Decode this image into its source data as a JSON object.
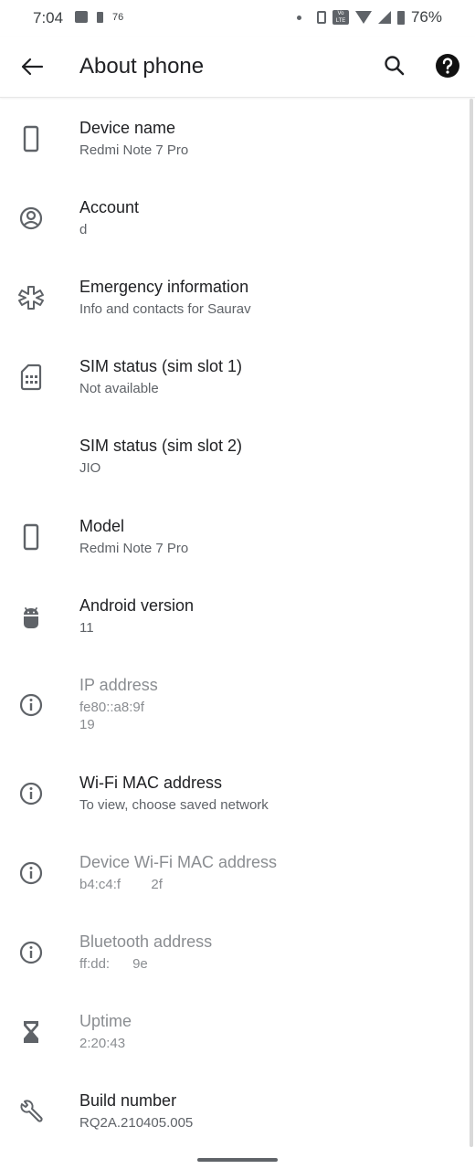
{
  "status_bar": {
    "time": "7:04",
    "small_indicator": "76",
    "volte_label": "Vo LTE",
    "battery_percent": "76%"
  },
  "toolbar": {
    "title": "About phone"
  },
  "items": [
    {
      "title": "Device name",
      "subtitle": "Redmi Note 7 Pro",
      "icon": "phone-icon"
    },
    {
      "title": "Account",
      "subtitle": "d",
      "icon": "account-circle-icon"
    },
    {
      "title": "Emergency information",
      "subtitle": "Info and contacts for Saurav",
      "icon": "medical-asterisk-icon"
    },
    {
      "title": "SIM status (sim slot 1)",
      "subtitle": "Not available",
      "icon": "sim-card-icon"
    },
    {
      "title": "SIM status (sim slot 2)",
      "subtitle": "JIO",
      "icon": ""
    },
    {
      "title": "Model",
      "subtitle": "Redmi Note 7 Pro",
      "icon": "phone-icon"
    },
    {
      "title": "Android version",
      "subtitle": "11",
      "icon": "android-icon"
    },
    {
      "title": "IP address",
      "subtitle": "fe80::a8:9f",
      "subtitle2": "19",
      "icon": "info-icon",
      "disabled": true
    },
    {
      "title": "Wi-Fi MAC address",
      "subtitle": "To view, choose saved network",
      "icon": "info-icon"
    },
    {
      "title": "Device Wi-Fi MAC address",
      "subtitle": "b4:c4:f        2f",
      "icon": "info-icon",
      "disabled": true
    },
    {
      "title": "Bluetooth address",
      "subtitle": "ff:dd:      9e",
      "icon": "info-icon",
      "disabled": true
    },
    {
      "title": "Uptime",
      "subtitle": "2:20:43",
      "icon": "hourglass-icon",
      "disabled": true
    },
    {
      "title": "Build number",
      "subtitle": "RQ2A.210405.005",
      "icon": "wrench-icon"
    }
  ],
  "colors": {
    "icon": "#5f6368",
    "title": "#202124",
    "subtitle": "#5f6368",
    "disabled": "#8a8d91"
  }
}
